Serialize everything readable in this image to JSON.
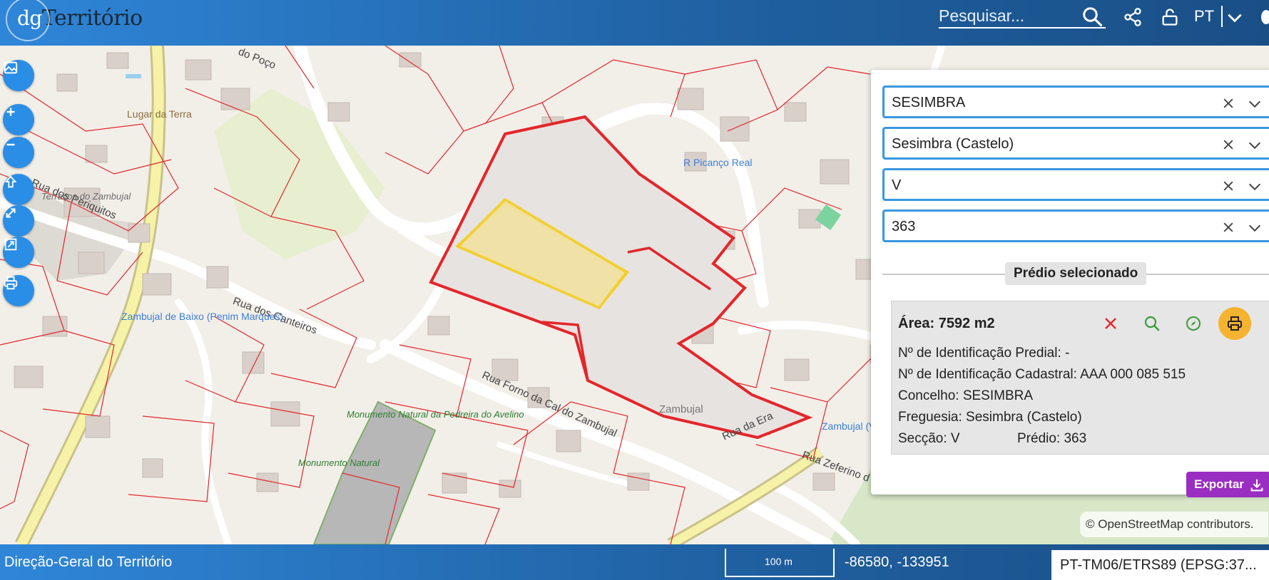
{
  "header": {
    "logo_prefix": "dg",
    "logo_text": "Território",
    "search_placeholder": "Pesquisar...",
    "language": "PT"
  },
  "map": {
    "labels": {
      "lugar": "Lugar da Terra",
      "rua_periquitos": "Rua dos Periquitos",
      "terracos": "Terraços do Zambujal",
      "rua_canteiros": "Rua dos Canteiros",
      "zambujal_baixo": "Zambujal de Baixo (Penim Marques)",
      "r_picanco": "R Picanço Real",
      "rua_forno": "Rua Forno da Cal do Zambujal",
      "zambujal": "Zambujal",
      "rua_era": "Rua da Era",
      "zambujal_vivenda": "Zambujal (Vivenda)",
      "rua_zeferino": "Rua Zeferino d",
      "monumento1": "Monumento Natural da Pedreira do Avelino",
      "monumento2": "Monumento Natural",
      "rua_poco": "do Poço"
    },
    "attribution": "© OpenStreetMap contributors."
  },
  "tools": [
    "image-icon",
    "zoom-in-icon",
    "zoom-out-icon",
    "home-icon",
    "fullscreen-icon",
    "extent-icon",
    "print-icon"
  ],
  "panel": {
    "concelho_value": "SESIMBRA",
    "freguesia_value": "Sesimbra (Castelo)",
    "seccao_value": "V",
    "predio_value": "363",
    "section_title": "Prédio selecionado",
    "area": "Área: 7592 m2",
    "nip": "Nº de Identificação Predial: -",
    "nic": "Nº de Identificação Cadastral: AAA 000 085 515",
    "concelho_line": "Concelho: SESIMBRA",
    "freguesia_line": "Freguesia: Sesimbra (Castelo)",
    "seccao_line": "Secção: V",
    "predio_line": "Prédio: 363",
    "export_label": "Exportar"
  },
  "footer": {
    "title": "Direção-Geral do Território",
    "scale": "100 m",
    "coords": "-86580, -133951",
    "crs": "PT-TM06/ETRS89 (EPSG:37..."
  },
  "colors": {
    "header": "#1f5f9f",
    "parcel": "#e3262b",
    "selected": "#f2cf2f",
    "select_border": "#3a97e0",
    "print_button": "#f6b32f",
    "export_button": "#9b2ec2"
  }
}
